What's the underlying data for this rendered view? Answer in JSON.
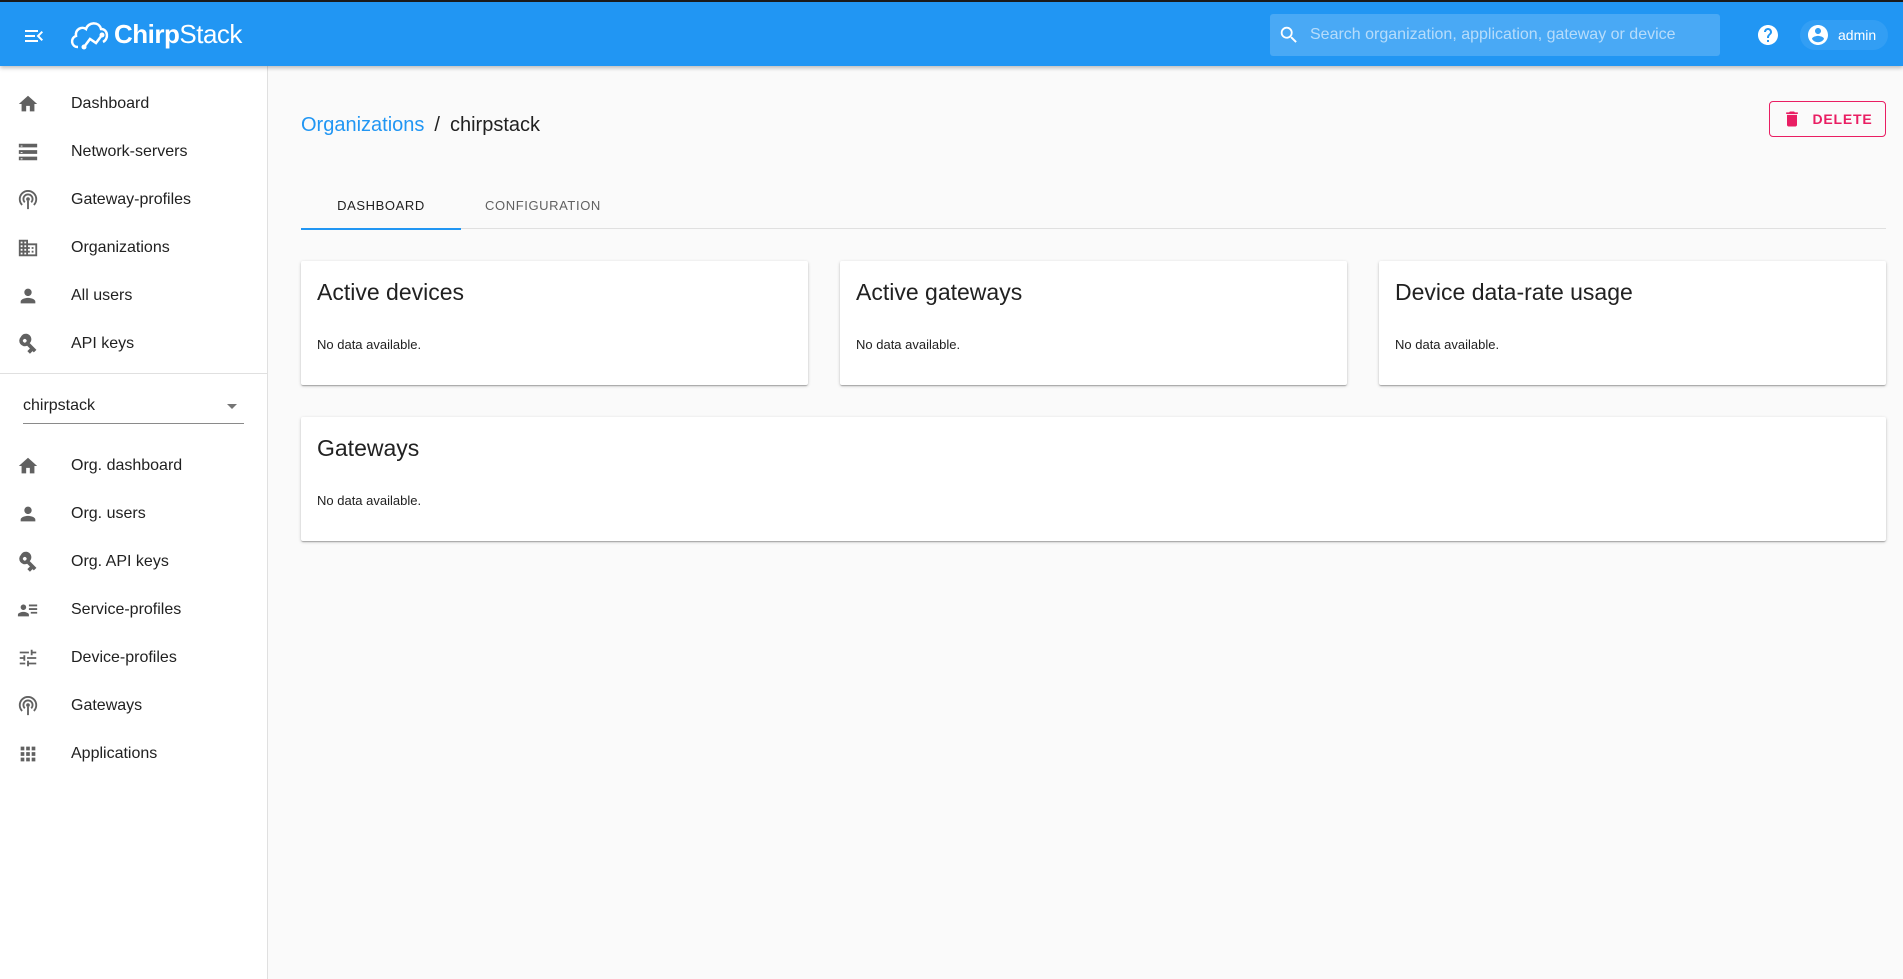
{
  "header": {
    "brand": "ChirpStack",
    "brand_bold": "Chirp",
    "brand_light": "Stack",
    "search_placeholder": "Search organization, application, gateway or device",
    "user": "admin",
    "color": "#2196f3"
  },
  "sidebar": {
    "global_items": [
      {
        "label": "Dashboard",
        "icon": "home-icon"
      },
      {
        "label": "Network-servers",
        "icon": "server-icon"
      },
      {
        "label": "Gateway-profiles",
        "icon": "broadcast-icon"
      },
      {
        "label": "Organizations",
        "icon": "building-icon"
      },
      {
        "label": "All users",
        "icon": "person-icon"
      },
      {
        "label": "API keys",
        "icon": "key-icon"
      }
    ],
    "org_select": "chirpstack",
    "org_items": [
      {
        "label": "Org. dashboard",
        "icon": "home-icon"
      },
      {
        "label": "Org. users",
        "icon": "person-icon"
      },
      {
        "label": "Org. API keys",
        "icon": "key-icon"
      },
      {
        "label": "Service-profiles",
        "icon": "account-details-icon"
      },
      {
        "label": "Device-profiles",
        "icon": "tune-icon"
      },
      {
        "label": "Gateways",
        "icon": "broadcast-icon"
      },
      {
        "label": "Applications",
        "icon": "apps-grid-icon"
      }
    ]
  },
  "main": {
    "breadcrumb": {
      "parent": "Organizations",
      "separator": "/",
      "current": "chirpstack"
    },
    "delete_label": "DELETE",
    "tabs": [
      {
        "label": "DASHBOARD",
        "active": true
      },
      {
        "label": "CONFIGURATION",
        "active": false
      }
    ],
    "cards": [
      {
        "title": "Active devices",
        "body": "No data available."
      },
      {
        "title": "Active gateways",
        "body": "No data available."
      },
      {
        "title": "Device data-rate usage",
        "body": "No data available."
      },
      {
        "title": "Gateways",
        "body": "No data available."
      }
    ],
    "accent": "#2196f3",
    "danger": "#e91e63"
  }
}
